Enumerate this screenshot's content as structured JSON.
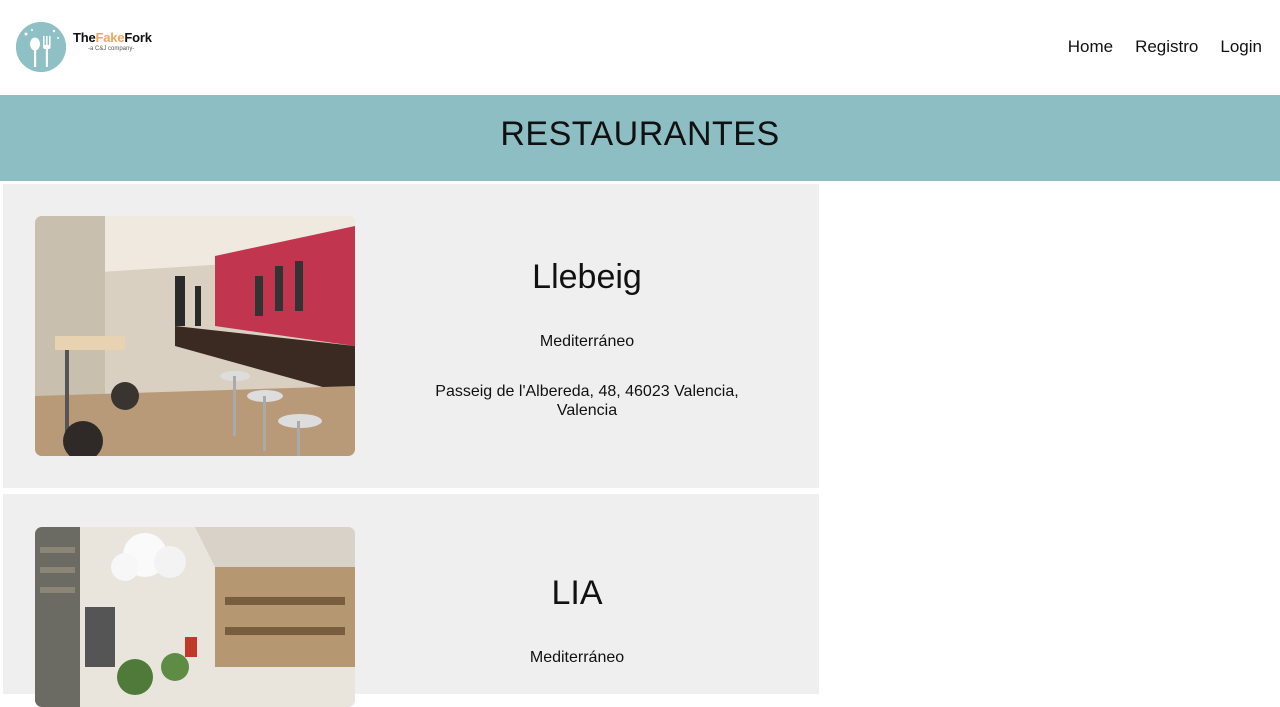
{
  "brand": {
    "name_part1": "The",
    "name_part2": "Fake",
    "name_part3": "Fork",
    "tagline": "-a C&J company-"
  },
  "nav": {
    "items": [
      "Home",
      "Registro",
      "Login"
    ]
  },
  "page": {
    "title": "RESTAURANTES"
  },
  "restaurants": [
    {
      "name": "Llebeig",
      "cuisine": "Mediterráneo",
      "address": "Passeig de l'Albereda, 48, 46023 Valencia, Valencia"
    },
    {
      "name": "LIA",
      "cuisine": "Mediterráneo"
    }
  ],
  "colors": {
    "accent": "#8dbec3",
    "card_bg": "#efefef",
    "logo_accent": "#f0a65a"
  }
}
